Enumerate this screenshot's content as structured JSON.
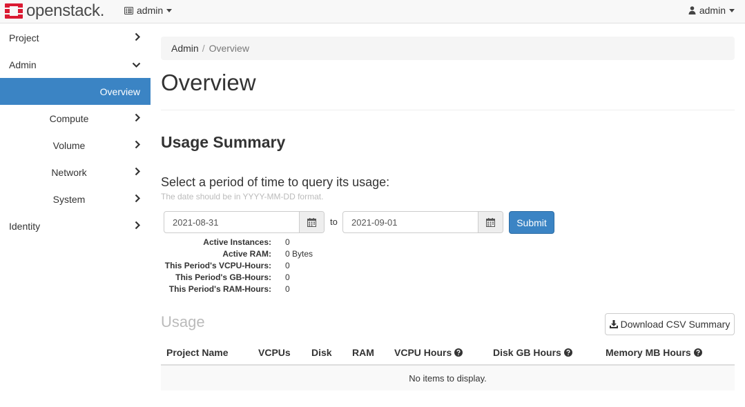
{
  "app": {
    "logo_text": "openstack.",
    "brand_color": "#da1a32"
  },
  "topbar": {
    "project_label": "admin",
    "user_label": "admin"
  },
  "sidebar": {
    "accent": "#3b84c4",
    "items": [
      {
        "label": "Project",
        "chevron": "right"
      },
      {
        "label": "Admin",
        "chevron": "down"
      },
      {
        "label": "Overview",
        "active": true
      },
      {
        "label": "Compute",
        "chevron": "right"
      },
      {
        "label": "Volume",
        "chevron": "right"
      },
      {
        "label": "Network",
        "chevron": "right"
      },
      {
        "label": "System",
        "chevron": "right"
      },
      {
        "label": "Identity",
        "chevron": "right"
      }
    ]
  },
  "breadcrumb": {
    "root": "Admin",
    "separator": "/",
    "current": "Overview"
  },
  "page": {
    "title": "Overview",
    "section_title": "Usage Summary"
  },
  "query": {
    "title": "Select a period of time to query its usage:",
    "help": "The date should be in YYYY-MM-DD format.",
    "start_date": "2021-08-31",
    "to_label": "to",
    "end_date": "2021-09-01",
    "submit_label": "Submit"
  },
  "stats": [
    {
      "label": "Active Instances:",
      "value": "0"
    },
    {
      "label": "Active RAM:",
      "value": "0 Bytes"
    },
    {
      "label": "This Period's VCPU-Hours:",
      "value": "0"
    },
    {
      "label": "This Period's GB-Hours:",
      "value": "0"
    },
    {
      "label": "This Period's RAM-Hours:",
      "value": "0"
    }
  ],
  "usage": {
    "title": "Usage",
    "download_label": "Download CSV Summary",
    "columns": [
      "Project Name",
      "VCPUs",
      "Disk",
      "RAM",
      "VCPU Hours",
      "Disk GB Hours",
      "Memory MB Hours"
    ],
    "empty_text": "No items to display."
  }
}
